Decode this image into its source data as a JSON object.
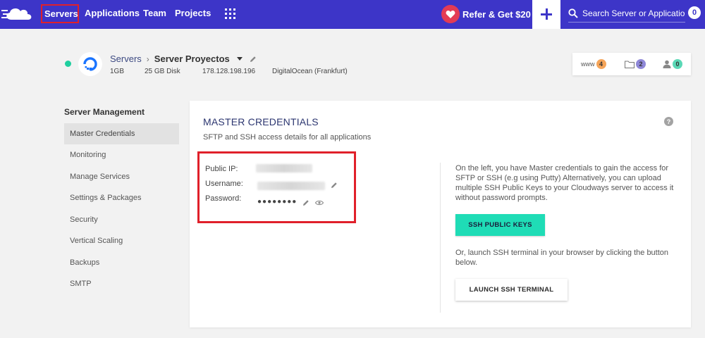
{
  "nav": {
    "items": [
      {
        "label": "Servers"
      },
      {
        "label": "Applications"
      },
      {
        "label": "Team"
      },
      {
        "label": "Projects"
      }
    ],
    "refer_label": "Refer & Get $20",
    "search_placeholder": "Search Server or Application",
    "notification_count": "0",
    "brand_color": "#3d35c8"
  },
  "server": {
    "breadcrumb_parent": "Servers",
    "name": "Server Proyectos",
    "status_color": "#1fcf9f",
    "ram": "1GB",
    "disk": "25 GB Disk",
    "ip": "178.128.198.196",
    "provider": "DigitalOcean (Frankfurt)"
  },
  "stats": {
    "www_label": "www",
    "www_count": "4",
    "folder_count": "2",
    "users_count": "0"
  },
  "sidebar": {
    "title": "Server Management",
    "items": [
      {
        "label": "Master Credentials",
        "active": true
      },
      {
        "label": "Monitoring"
      },
      {
        "label": "Manage Services"
      },
      {
        "label": "Settings & Packages"
      },
      {
        "label": "Security"
      },
      {
        "label": "Vertical Scaling"
      },
      {
        "label": "Backups"
      },
      {
        "label": "SMTP"
      }
    ]
  },
  "panel": {
    "title": "MASTER CREDENTIALS",
    "subtitle": "SFTP and SSH access details for all applications",
    "help": "?",
    "public_ip_label": "Public IP:",
    "username_label": "Username:",
    "password_label": "Password:",
    "password_masked": "●●●●●●●●",
    "info_text": "On the left, you have Master credentials to gain the access for SFTP or SSH (e.g using Putty) Alternatively, you can upload multiple SSH Public Keys to your Cloudways server to access it without password prompts.",
    "ssh_keys_button": "SSH PUBLIC KEYS",
    "info_text2": "Or, launch SSH terminal in your browser by clicking the button below.",
    "terminal_button": "LAUNCH SSH TERMINAL",
    "accent_color": "#1fdcb6"
  }
}
